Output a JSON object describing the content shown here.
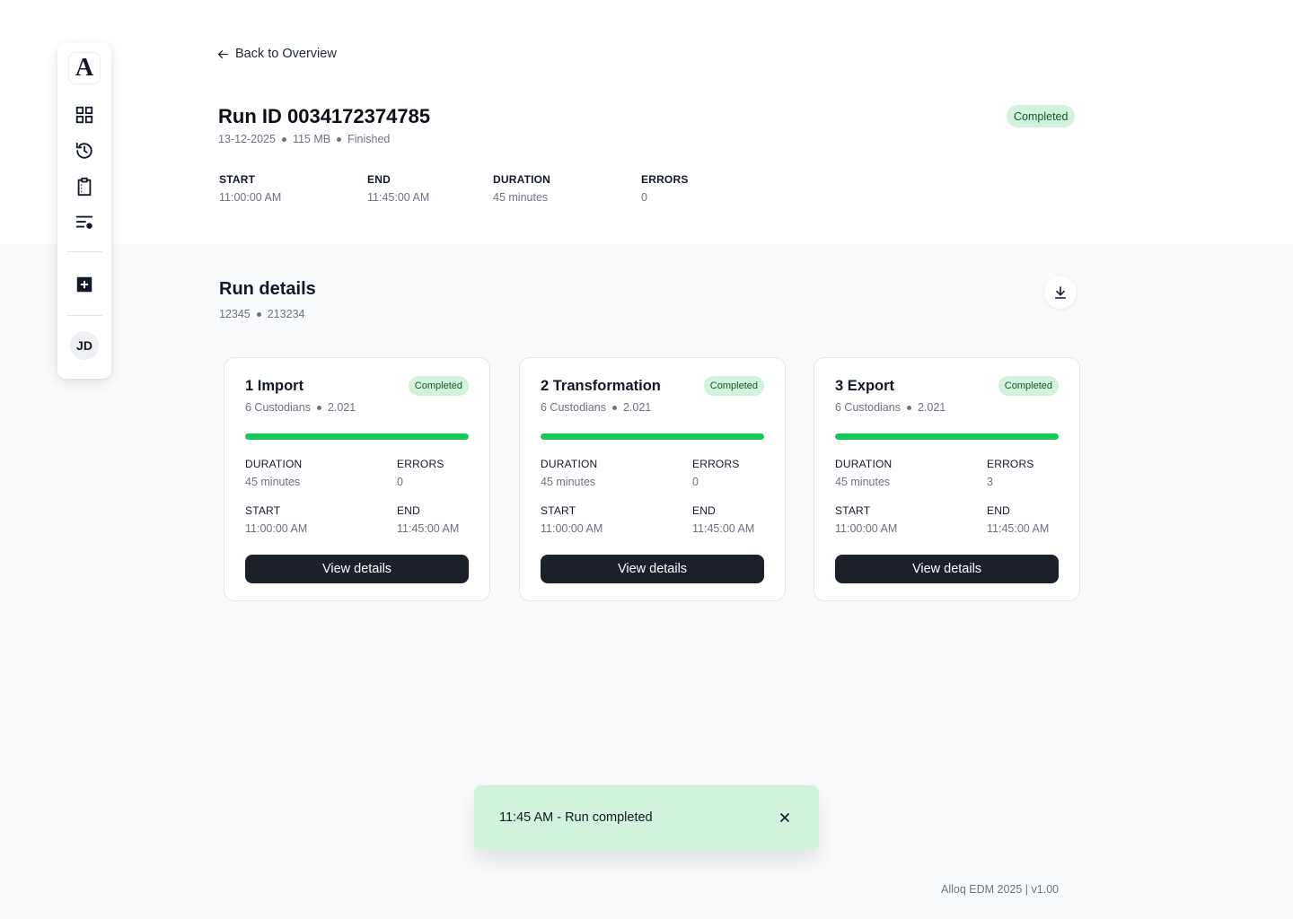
{
  "sidebar": {
    "logo_text": "A",
    "items": [
      {
        "icon": "grid-icon"
      },
      {
        "icon": "history-icon"
      },
      {
        "icon": "clipboard-icon"
      },
      {
        "icon": "list-settings-icon"
      }
    ],
    "add_icon": "plus-square-icon",
    "avatar_initials": "JD"
  },
  "header": {
    "back_label": "Back to Overview",
    "run_title": "Run ID 0034172374785",
    "date": "13-12-2025",
    "size": "115 MB",
    "state": "Finished",
    "status_badge": "Completed",
    "stats": [
      {
        "label": "START",
        "value": "11:00:00 AM"
      },
      {
        "label": "END",
        "value": "11:45:00 AM"
      },
      {
        "label": "DURATION",
        "value": "45 minutes"
      },
      {
        "label": "ERRORS",
        "value": "0"
      }
    ]
  },
  "run_details": {
    "title": "Run details",
    "sub_a": "12345",
    "sub_b": "213234",
    "download_icon": "download-icon",
    "cards": [
      {
        "title": "1 Import",
        "badge": "Completed",
        "custodians": "6 Custodians",
        "version": "2.021",
        "progress": 1.0,
        "duration_label": "DURATION",
        "duration": "45 minutes",
        "errors_label": "ERRORS",
        "errors": "0",
        "start_label": "START",
        "start": "11:00:00 AM",
        "end_label": "END",
        "end": "11:45:00 AM",
        "button": "View details"
      },
      {
        "title": "2 Transformation",
        "badge": "Completed",
        "custodians": "6 Custodians",
        "version": "2.021",
        "progress": 1.0,
        "duration_label": "DURATION",
        "duration": "45 minutes",
        "errors_label": "ERRORS",
        "errors": "0",
        "start_label": "START",
        "start": "11:00:00 AM",
        "end_label": "END",
        "end": "11:45:00 AM",
        "button": "View details"
      },
      {
        "title": "3 Export",
        "badge": "Completed",
        "custodians": "6 Custodians",
        "version": "2.021",
        "progress": 1.0,
        "duration_label": "DURATION",
        "duration": "45 minutes",
        "errors_label": "ERRORS",
        "errors": "3",
        "start_label": "START",
        "start": "11:00:00 AM",
        "end_label": "END",
        "end": "11:45:00 AM",
        "button": "View details"
      }
    ]
  },
  "toast": {
    "text": "11:45 AM - Run completed",
    "close_icon": "close-icon"
  },
  "footer": {
    "text": "Alloq EDM 2025 | v1.00"
  },
  "colors": {
    "accent_green": "#16c85a",
    "badge_bg": "#d1f3dc",
    "button_dark": "#1b2029",
    "page_bg": "#f9fafb"
  }
}
